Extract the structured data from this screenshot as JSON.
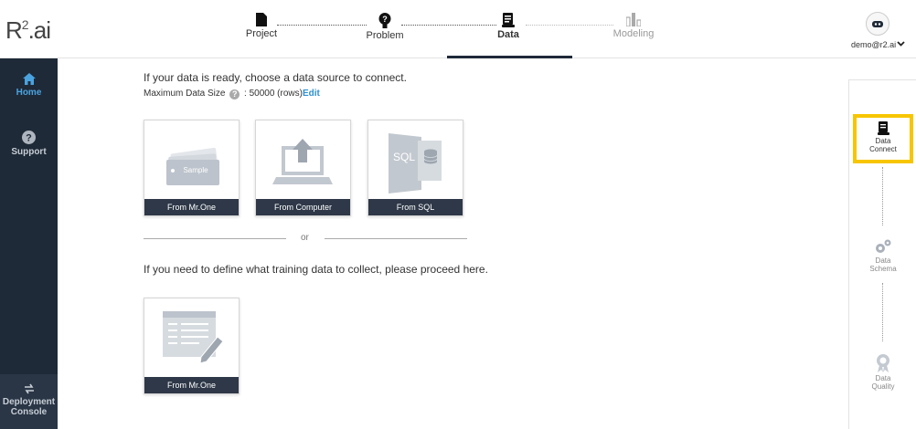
{
  "logo": {
    "main": "R",
    "sup": "2",
    "suffix": ".ai"
  },
  "sidebar": {
    "items": [
      {
        "label": "Home",
        "icon": "home-icon",
        "active": true
      },
      {
        "label": "Support",
        "icon": "help-icon",
        "active": false
      }
    ],
    "deploy": {
      "line1": "Deployment",
      "line2": "Console",
      "icon": "deploy-icon"
    }
  },
  "header": {
    "steps": [
      {
        "label": "Project",
        "icon": "file-icon"
      },
      {
        "label": "Problem",
        "icon": "lightbulb-icon"
      },
      {
        "label": "Data",
        "icon": "data-scroll-icon",
        "active": true
      },
      {
        "label": "Modeling",
        "icon": "bar-chart-icon",
        "disabled": true
      }
    ],
    "user_email": "demo@r2.ai"
  },
  "main": {
    "intro": "If your data is ready, choose a data source to connect.",
    "max_size_label": "Maximum Data Size",
    "max_size_value": ": 50000 (rows)",
    "edit_label": "Edit",
    "cards": [
      {
        "label": "From Mr.One",
        "icon": "sample-cards-icon",
        "tag": "Sample"
      },
      {
        "label": "From Computer",
        "icon": "upload-laptop-icon"
      },
      {
        "label": "From SQL",
        "icon": "sql-database-icon",
        "tag": "SQL"
      }
    ],
    "or_label": "or",
    "define_text": "If you need to define what training data to collect, please proceed here.",
    "define_card": {
      "label": "From Mr.One",
      "icon": "form-edit-icon"
    }
  },
  "right_panel": {
    "steps": [
      {
        "line1": "Data",
        "line2": "Connect",
        "active": true
      },
      {
        "line1": "Data",
        "line2": "Schema"
      },
      {
        "line1": "Data",
        "line2": "Quality"
      }
    ]
  },
  "colors": {
    "sidebar": "#1f2a38",
    "accent": "#4aa3df",
    "highlight": "#f7c600",
    "card_label": "#2e3848"
  }
}
